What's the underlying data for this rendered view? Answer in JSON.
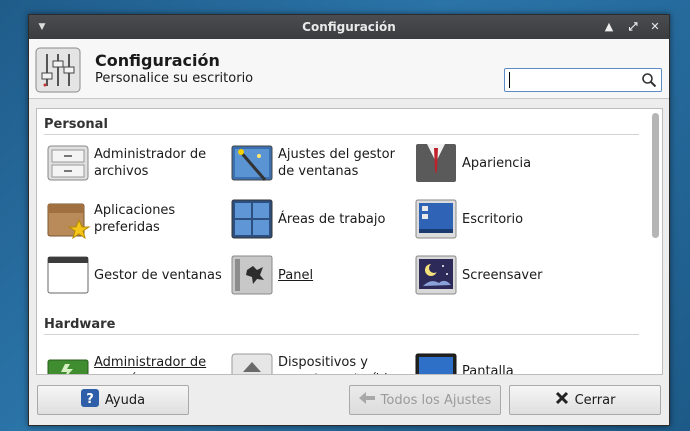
{
  "window": {
    "title": "Configuración"
  },
  "header": {
    "title": "Configuración",
    "subtitle": "Personalice su escritorio",
    "search_placeholder": ""
  },
  "sections": [
    {
      "title": "Personal",
      "items": [
        {
          "label": "Administrador de archivos",
          "icon": "file-manager-icon"
        },
        {
          "label": "Ajustes del gestor de ventanas",
          "icon": "window-manager-tweaks-icon"
        },
        {
          "label": "Apariencia",
          "icon": "appearance-icon"
        },
        {
          "label": "Aplicaciones preferidas",
          "icon": "preferred-applications-icon"
        },
        {
          "label": "Áreas de trabajo",
          "icon": "workspaces-icon"
        },
        {
          "label": "Escritorio",
          "icon": "desktop-icon"
        },
        {
          "label": "Gestor de ventanas",
          "icon": "window-manager-icon"
        },
        {
          "label": "Panel",
          "icon": "panel-icon"
        },
        {
          "label": "Screensaver",
          "icon": "screensaver-icon"
        }
      ]
    },
    {
      "title": "Hardware",
      "items": [
        {
          "label": "Administrador de energía",
          "icon": "power-manager-icon"
        },
        {
          "label": "Dispositivos y soportes extraíbles",
          "icon": "removable-drives-icon"
        },
        {
          "label": "Pantalla",
          "icon": "display-icon"
        }
      ]
    }
  ],
  "footer": {
    "help_label": "Ayuda",
    "all_settings_label": "Todos los Ajustes",
    "close_label": "Cerrar"
  },
  "colors": {
    "accent": "#5b8ac4",
    "titlebar": "#3f4245",
    "desktop": "#2b74a8"
  }
}
